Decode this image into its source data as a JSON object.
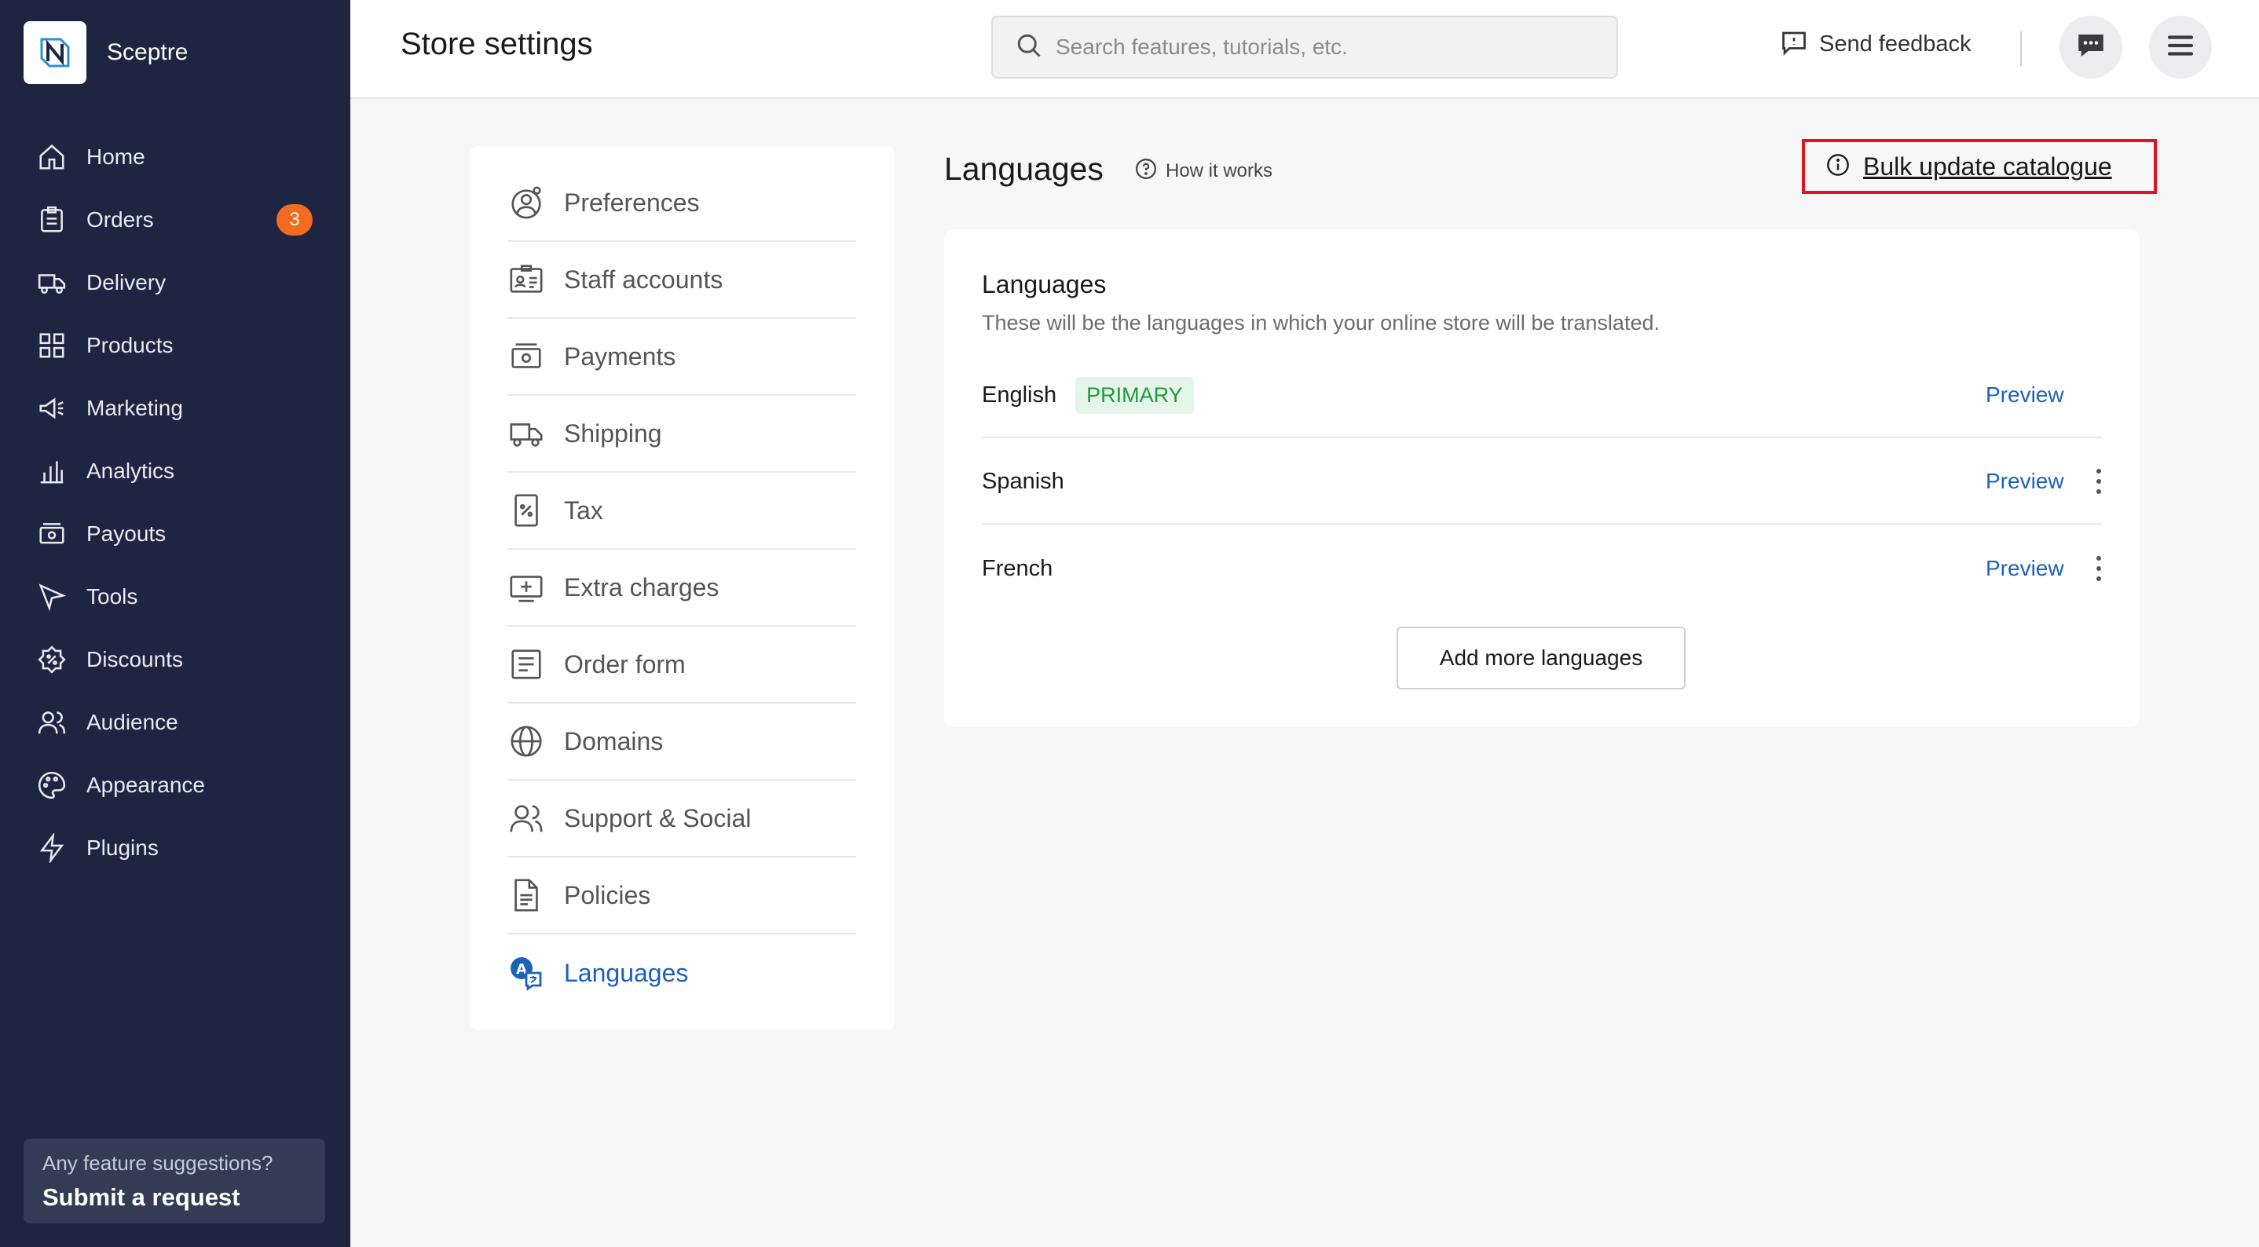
{
  "sidebar": {
    "brand": "Sceptre",
    "nav": [
      {
        "label": "Home",
        "icon": "home-icon"
      },
      {
        "label": "Orders",
        "icon": "orders-icon",
        "badge": "3"
      },
      {
        "label": "Delivery",
        "icon": "truck-icon"
      },
      {
        "label": "Products",
        "icon": "grid-icon"
      },
      {
        "label": "Marketing",
        "icon": "megaphone-icon"
      },
      {
        "label": "Analytics",
        "icon": "bar-chart-icon"
      },
      {
        "label": "Payouts",
        "icon": "payouts-icon"
      },
      {
        "label": "Tools",
        "icon": "cursor-icon"
      },
      {
        "label": "Discounts",
        "icon": "discount-icon"
      },
      {
        "label": "Audience",
        "icon": "people-icon"
      },
      {
        "label": "Appearance",
        "icon": "palette-icon"
      },
      {
        "label": "Plugins",
        "icon": "bolt-icon"
      }
    ],
    "suggestion": {
      "question": "Any feature suggestions?",
      "cta": "Submit a request"
    }
  },
  "header": {
    "title": "Store settings",
    "search_placeholder": "Search features, tutorials, etc.",
    "feedback_label": "Send feedback"
  },
  "settings_menu": [
    {
      "label": "Preferences",
      "icon": "preferences-icon"
    },
    {
      "label": "Staff accounts",
      "icon": "id-card-icon"
    },
    {
      "label": "Payments",
      "icon": "payments-icon"
    },
    {
      "label": "Shipping",
      "icon": "truck-icon"
    },
    {
      "label": "Tax",
      "icon": "tax-icon"
    },
    {
      "label": "Extra charges",
      "icon": "extra-charges-icon"
    },
    {
      "label": "Order form",
      "icon": "form-icon"
    },
    {
      "label": "Domains",
      "icon": "globe-icon"
    },
    {
      "label": "Support & Social",
      "icon": "people-icon"
    },
    {
      "label": "Policies",
      "icon": "document-icon"
    },
    {
      "label": "Languages",
      "icon": "translate-icon",
      "active": true
    }
  ],
  "languages_section": {
    "title": "Languages",
    "how_it_works": "How it works",
    "bulk_update": "Bulk update catalogue",
    "card": {
      "title": "Languages",
      "subtitle": "These will be the languages in which your online store will be translated.",
      "rows": [
        {
          "name": "English",
          "badge": "PRIMARY",
          "preview": "Preview"
        },
        {
          "name": "Spanish",
          "preview": "Preview"
        },
        {
          "name": "French",
          "preview": "Preview"
        }
      ],
      "add_button": "Add more languages"
    }
  },
  "colors": {
    "sidebar_bg": "#1e2540",
    "accent_blue": "#1d62b8",
    "badge_orange": "#f26b21",
    "highlight_red": "#e0141e",
    "primary_green": "#1f9a3a"
  }
}
